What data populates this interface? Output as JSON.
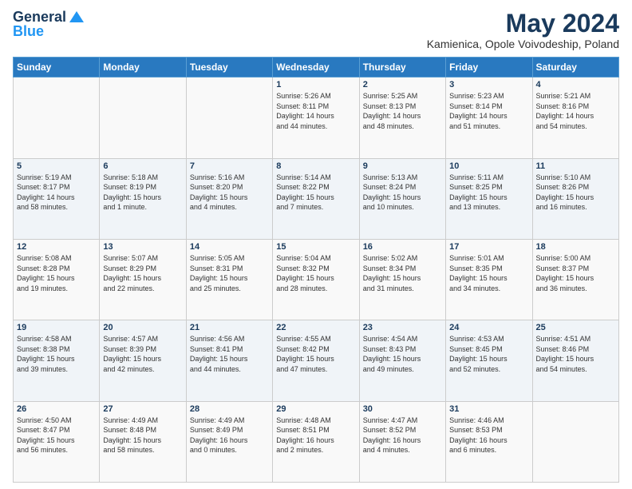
{
  "logo": {
    "line1": "General",
    "line2": "Blue"
  },
  "title": "May 2024",
  "location": "Kamienica, Opole Voivodeship, Poland",
  "weekdays": [
    "Sunday",
    "Monday",
    "Tuesday",
    "Wednesday",
    "Thursday",
    "Friday",
    "Saturday"
  ],
  "weeks": [
    [
      {
        "day": "",
        "info": ""
      },
      {
        "day": "",
        "info": ""
      },
      {
        "day": "",
        "info": ""
      },
      {
        "day": "1",
        "info": "Sunrise: 5:26 AM\nSunset: 8:11 PM\nDaylight: 14 hours\nand 44 minutes."
      },
      {
        "day": "2",
        "info": "Sunrise: 5:25 AM\nSunset: 8:13 PM\nDaylight: 14 hours\nand 48 minutes."
      },
      {
        "day": "3",
        "info": "Sunrise: 5:23 AM\nSunset: 8:14 PM\nDaylight: 14 hours\nand 51 minutes."
      },
      {
        "day": "4",
        "info": "Sunrise: 5:21 AM\nSunset: 8:16 PM\nDaylight: 14 hours\nand 54 minutes."
      }
    ],
    [
      {
        "day": "5",
        "info": "Sunrise: 5:19 AM\nSunset: 8:17 PM\nDaylight: 14 hours\nand 58 minutes."
      },
      {
        "day": "6",
        "info": "Sunrise: 5:18 AM\nSunset: 8:19 PM\nDaylight: 15 hours\nand 1 minute."
      },
      {
        "day": "7",
        "info": "Sunrise: 5:16 AM\nSunset: 8:20 PM\nDaylight: 15 hours\nand 4 minutes."
      },
      {
        "day": "8",
        "info": "Sunrise: 5:14 AM\nSunset: 8:22 PM\nDaylight: 15 hours\nand 7 minutes."
      },
      {
        "day": "9",
        "info": "Sunrise: 5:13 AM\nSunset: 8:24 PM\nDaylight: 15 hours\nand 10 minutes."
      },
      {
        "day": "10",
        "info": "Sunrise: 5:11 AM\nSunset: 8:25 PM\nDaylight: 15 hours\nand 13 minutes."
      },
      {
        "day": "11",
        "info": "Sunrise: 5:10 AM\nSunset: 8:26 PM\nDaylight: 15 hours\nand 16 minutes."
      }
    ],
    [
      {
        "day": "12",
        "info": "Sunrise: 5:08 AM\nSunset: 8:28 PM\nDaylight: 15 hours\nand 19 minutes."
      },
      {
        "day": "13",
        "info": "Sunrise: 5:07 AM\nSunset: 8:29 PM\nDaylight: 15 hours\nand 22 minutes."
      },
      {
        "day": "14",
        "info": "Sunrise: 5:05 AM\nSunset: 8:31 PM\nDaylight: 15 hours\nand 25 minutes."
      },
      {
        "day": "15",
        "info": "Sunrise: 5:04 AM\nSunset: 8:32 PM\nDaylight: 15 hours\nand 28 minutes."
      },
      {
        "day": "16",
        "info": "Sunrise: 5:02 AM\nSunset: 8:34 PM\nDaylight: 15 hours\nand 31 minutes."
      },
      {
        "day": "17",
        "info": "Sunrise: 5:01 AM\nSunset: 8:35 PM\nDaylight: 15 hours\nand 34 minutes."
      },
      {
        "day": "18",
        "info": "Sunrise: 5:00 AM\nSunset: 8:37 PM\nDaylight: 15 hours\nand 36 minutes."
      }
    ],
    [
      {
        "day": "19",
        "info": "Sunrise: 4:58 AM\nSunset: 8:38 PM\nDaylight: 15 hours\nand 39 minutes."
      },
      {
        "day": "20",
        "info": "Sunrise: 4:57 AM\nSunset: 8:39 PM\nDaylight: 15 hours\nand 42 minutes."
      },
      {
        "day": "21",
        "info": "Sunrise: 4:56 AM\nSunset: 8:41 PM\nDaylight: 15 hours\nand 44 minutes."
      },
      {
        "day": "22",
        "info": "Sunrise: 4:55 AM\nSunset: 8:42 PM\nDaylight: 15 hours\nand 47 minutes."
      },
      {
        "day": "23",
        "info": "Sunrise: 4:54 AM\nSunset: 8:43 PM\nDaylight: 15 hours\nand 49 minutes."
      },
      {
        "day": "24",
        "info": "Sunrise: 4:53 AM\nSunset: 8:45 PM\nDaylight: 15 hours\nand 52 minutes."
      },
      {
        "day": "25",
        "info": "Sunrise: 4:51 AM\nSunset: 8:46 PM\nDaylight: 15 hours\nand 54 minutes."
      }
    ],
    [
      {
        "day": "26",
        "info": "Sunrise: 4:50 AM\nSunset: 8:47 PM\nDaylight: 15 hours\nand 56 minutes."
      },
      {
        "day": "27",
        "info": "Sunrise: 4:49 AM\nSunset: 8:48 PM\nDaylight: 15 hours\nand 58 minutes."
      },
      {
        "day": "28",
        "info": "Sunrise: 4:49 AM\nSunset: 8:49 PM\nDaylight: 16 hours\nand 0 minutes."
      },
      {
        "day": "29",
        "info": "Sunrise: 4:48 AM\nSunset: 8:51 PM\nDaylight: 16 hours\nand 2 minutes."
      },
      {
        "day": "30",
        "info": "Sunrise: 4:47 AM\nSunset: 8:52 PM\nDaylight: 16 hours\nand 4 minutes."
      },
      {
        "day": "31",
        "info": "Sunrise: 4:46 AM\nSunset: 8:53 PM\nDaylight: 16 hours\nand 6 minutes."
      },
      {
        "day": "",
        "info": ""
      }
    ]
  ]
}
